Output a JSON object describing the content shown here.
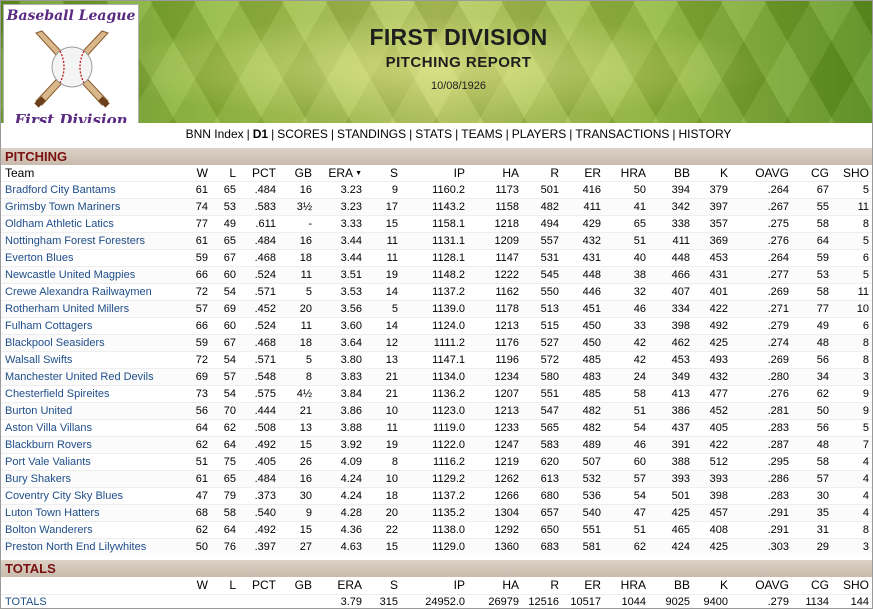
{
  "logo": {
    "top_text": "Baseball League",
    "bottom_text": "First Division",
    "icon": "baseball-crossed-bats-icon"
  },
  "header": {
    "title": "FIRST DIVISION",
    "subtitle": "PITCHING REPORT",
    "date": "10/08/1926"
  },
  "nav": [
    {
      "label": "BNN Index",
      "active": false
    },
    {
      "label": "D1",
      "active": true
    },
    {
      "label": "SCORES",
      "active": false
    },
    {
      "label": "STANDINGS",
      "active": false
    },
    {
      "label": "STATS",
      "active": false
    },
    {
      "label": "TEAMS",
      "active": false
    },
    {
      "label": "PLAYERS",
      "active": false
    },
    {
      "label": "TRANSACTIONS",
      "active": false
    },
    {
      "label": "HISTORY",
      "active": false
    }
  ],
  "pitching": {
    "section_title": "PITCHING",
    "sorted_by": "ERA",
    "sort_icon": "sort-down-icon",
    "columns": [
      "Team",
      "W",
      "L",
      "PCT",
      "GB",
      "ERA",
      "S",
      "IP",
      "HA",
      "R",
      "ER",
      "HRA",
      "BB",
      "K",
      "OAVG",
      "CG",
      "SHO"
    ],
    "rows": [
      [
        "Bradford City Bantams",
        "61",
        "65",
        ".484",
        "16",
        "3.23",
        "9",
        "1160.2",
        "1173",
        "501",
        "416",
        "50",
        "394",
        "379",
        ".264",
        "67",
        "5"
      ],
      [
        "Grimsby Town Mariners",
        "74",
        "53",
        ".583",
        "3½",
        "3.23",
        "17",
        "1143.2",
        "1158",
        "482",
        "411",
        "41",
        "342",
        "397",
        ".267",
        "55",
        "11"
      ],
      [
        "Oldham Athletic Latics",
        "77",
        "49",
        ".611",
        "-",
        "3.33",
        "15",
        "1158.1",
        "1218",
        "494",
        "429",
        "65",
        "338",
        "357",
        ".275",
        "58",
        "8"
      ],
      [
        "Nottingham Forest Foresters",
        "61",
        "65",
        ".484",
        "16",
        "3.44",
        "11",
        "1131.1",
        "1209",
        "557",
        "432",
        "51",
        "411",
        "369",
        ".276",
        "64",
        "5"
      ],
      [
        "Everton Blues",
        "59",
        "67",
        ".468",
        "18",
        "3.44",
        "11",
        "1128.1",
        "1147",
        "531",
        "431",
        "40",
        "448",
        "453",
        ".264",
        "59",
        "6"
      ],
      [
        "Newcastle United Magpies",
        "66",
        "60",
        ".524",
        "11",
        "3.51",
        "19",
        "1148.2",
        "1222",
        "545",
        "448",
        "38",
        "466",
        "431",
        ".277",
        "53",
        "5"
      ],
      [
        "Crewe Alexandra Railwaymen",
        "72",
        "54",
        ".571",
        "5",
        "3.53",
        "14",
        "1137.2",
        "1162",
        "550",
        "446",
        "32",
        "407",
        "401",
        ".269",
        "58",
        "11"
      ],
      [
        "Rotherham United Millers",
        "57",
        "69",
        ".452",
        "20",
        "3.56",
        "5",
        "1139.0",
        "1178",
        "513",
        "451",
        "46",
        "334",
        "422",
        ".271",
        "77",
        "10"
      ],
      [
        "Fulham Cottagers",
        "66",
        "60",
        ".524",
        "11",
        "3.60",
        "14",
        "1124.0",
        "1213",
        "515",
        "450",
        "33",
        "398",
        "492",
        ".279",
        "49",
        "6"
      ],
      [
        "Blackpool Seasiders",
        "59",
        "67",
        ".468",
        "18",
        "3.64",
        "12",
        "1111.2",
        "1176",
        "527",
        "450",
        "42",
        "462",
        "425",
        ".274",
        "48",
        "8"
      ],
      [
        "Walsall Swifts",
        "72",
        "54",
        ".571",
        "5",
        "3.80",
        "13",
        "1147.1",
        "1196",
        "572",
        "485",
        "42",
        "453",
        "493",
        ".269",
        "56",
        "8"
      ],
      [
        "Manchester United Red Devils",
        "69",
        "57",
        ".548",
        "8",
        "3.83",
        "21",
        "1134.0",
        "1234",
        "580",
        "483",
        "24",
        "349",
        "432",
        ".280",
        "34",
        "3"
      ],
      [
        "Chesterfield Spireites",
        "73",
        "54",
        ".575",
        "4½",
        "3.84",
        "21",
        "1136.2",
        "1207",
        "551",
        "485",
        "58",
        "413",
        "477",
        ".276",
        "62",
        "9"
      ],
      [
        "Burton United",
        "56",
        "70",
        ".444",
        "21",
        "3.86",
        "10",
        "1123.0",
        "1213",
        "547",
        "482",
        "51",
        "386",
        "452",
        ".281",
        "50",
        "9"
      ],
      [
        "Aston Villa Villans",
        "64",
        "62",
        ".508",
        "13",
        "3.88",
        "11",
        "1119.0",
        "1233",
        "565",
        "482",
        "54",
        "437",
        "405",
        ".283",
        "56",
        "5"
      ],
      [
        "Blackburn Rovers",
        "62",
        "64",
        ".492",
        "15",
        "3.92",
        "19",
        "1122.0",
        "1247",
        "583",
        "489",
        "46",
        "391",
        "422",
        ".287",
        "48",
        "7"
      ],
      [
        "Port Vale Valiants",
        "51",
        "75",
        ".405",
        "26",
        "4.09",
        "8",
        "1116.2",
        "1219",
        "620",
        "507",
        "60",
        "388",
        "512",
        ".295",
        "58",
        "4"
      ],
      [
        "Bury Shakers",
        "61",
        "65",
        ".484",
        "16",
        "4.24",
        "10",
        "1129.2",
        "1262",
        "613",
        "532",
        "57",
        "393",
        "393",
        ".286",
        "57",
        "4"
      ],
      [
        "Coventry City Sky Blues",
        "47",
        "79",
        ".373",
        "30",
        "4.24",
        "18",
        "1137.2",
        "1266",
        "680",
        "536",
        "54",
        "501",
        "398",
        ".283",
        "30",
        "4"
      ],
      [
        "Luton Town Hatters",
        "68",
        "58",
        ".540",
        "9",
        "4.28",
        "20",
        "1135.2",
        "1304",
        "657",
        "540",
        "47",
        "425",
        "457",
        ".291",
        "35",
        "4"
      ],
      [
        "Bolton Wanderers",
        "62",
        "64",
        ".492",
        "15",
        "4.36",
        "22",
        "1138.0",
        "1292",
        "650",
        "551",
        "51",
        "465",
        "408",
        ".291",
        "31",
        "8"
      ],
      [
        "Preston North End Lilywhites",
        "50",
        "76",
        ".397",
        "27",
        "4.63",
        "15",
        "1129.0",
        "1360",
        "683",
        "581",
        "62",
        "424",
        "425",
        ".303",
        "29",
        "3"
      ]
    ]
  },
  "totals": {
    "section_title": "TOTALS",
    "columns": [
      "",
      "W",
      "L",
      "PCT",
      "GB",
      "ERA",
      "S",
      "IP",
      "HA",
      "R",
      "ER",
      "HRA",
      "BB",
      "K",
      "OAVG",
      "CG",
      "SHO"
    ],
    "row": [
      "TOTALS",
      "",
      "",
      "",
      "",
      "3.79",
      "315",
      "24952.0",
      "26979",
      "12516",
      "10517",
      "1044",
      "9025",
      "9400",
      ".279",
      "1134",
      "144"
    ]
  }
}
